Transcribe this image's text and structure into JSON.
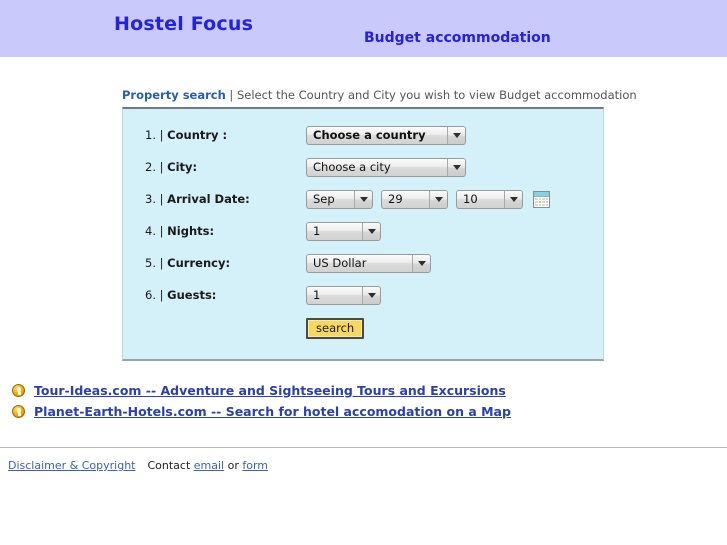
{
  "header": {
    "site_title": "Hostel Focus",
    "tagline": "Budget accommodation",
    "band_color": "#c9c9fb",
    "title_color": "#2222e0"
  },
  "search_section": {
    "heading_strong": "Property search",
    "heading_rest": " | Select the Country and City you wish to view Budget accommodation",
    "panel_color": "#d4f0f8",
    "rows": [
      {
        "index": "1. | ",
        "label": "Country :",
        "field": "country-select",
        "value": "Choose a country"
      },
      {
        "index": "2. | ",
        "label": "City:",
        "field": "city-select",
        "value": "Choose a city"
      },
      {
        "index": "3. | ",
        "label": "Arrival Date:",
        "field": "arrival-date",
        "month": "Sep",
        "day": "29",
        "year": "10",
        "calendar_icon": "calendar-icon"
      },
      {
        "index": "4. | ",
        "label": "Nights:",
        "field": "nights-select",
        "value": "1"
      },
      {
        "index": "5. | ",
        "label": "Currency:",
        "field": "currency-select",
        "value": "US Dollar"
      },
      {
        "index": "6. | ",
        "label": "Guests:",
        "field": "guests-select",
        "value": "1"
      }
    ],
    "search_button_label": "search",
    "search_button_color": "#f6d860"
  },
  "promo": {
    "icon": "lightbulb-icon",
    "links": [
      "Tour-Ideas.com -- Adventure and Sightseeing Tours and Excursions",
      "Planet-Earth-Hotels.com -- Search for hotel accomodation on a Map"
    ],
    "link_color": "#2a3fb0"
  },
  "footer": {
    "disclaimer": "Disclaimer & Copyright",
    "contact_text": "Contact ",
    "email_link": "email",
    "or_text": " or ",
    "form_link": "form"
  }
}
